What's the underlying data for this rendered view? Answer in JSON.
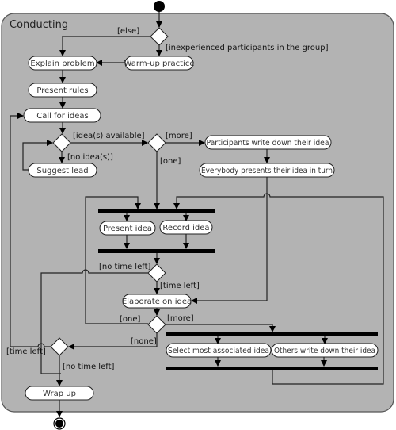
{
  "container": {
    "title": "Conducting",
    "fill": "#b3b3b3",
    "stroke": "#555555"
  },
  "actions": {
    "explain_problem": "Explain problem",
    "warm_up_practice": "Warm-up practice",
    "present_rules": "Present rules",
    "call_for_ideas": "Call for ideas",
    "suggest_lead": "Suggest lead",
    "participants_write": "Participants write down their idea",
    "everybody_presents": "Everybody presents their idea in turn",
    "present_idea": "Present idea",
    "record_idea": "Record idea",
    "elaborate_on_idea": "Elaborate on idea",
    "select_most_associated": "Select most associated idea",
    "others_write": "Others write down their idea",
    "wrap_up": "Wrap up"
  },
  "guards": {
    "else": "[else]",
    "inexperienced": "[inexperienced participants in the group]",
    "ideas_available": "[idea(s) available]",
    "no_ideas": "[no idea(s)]",
    "more_1": "[more]",
    "one_1": "[one]",
    "no_time_left_1": "[no time left]",
    "time_left_1": "[time left]",
    "one_2": "[one]",
    "more_2": "[more]",
    "none": "[none]",
    "time_left_2": "[time left]",
    "no_time_left_2": "[no time left]"
  }
}
